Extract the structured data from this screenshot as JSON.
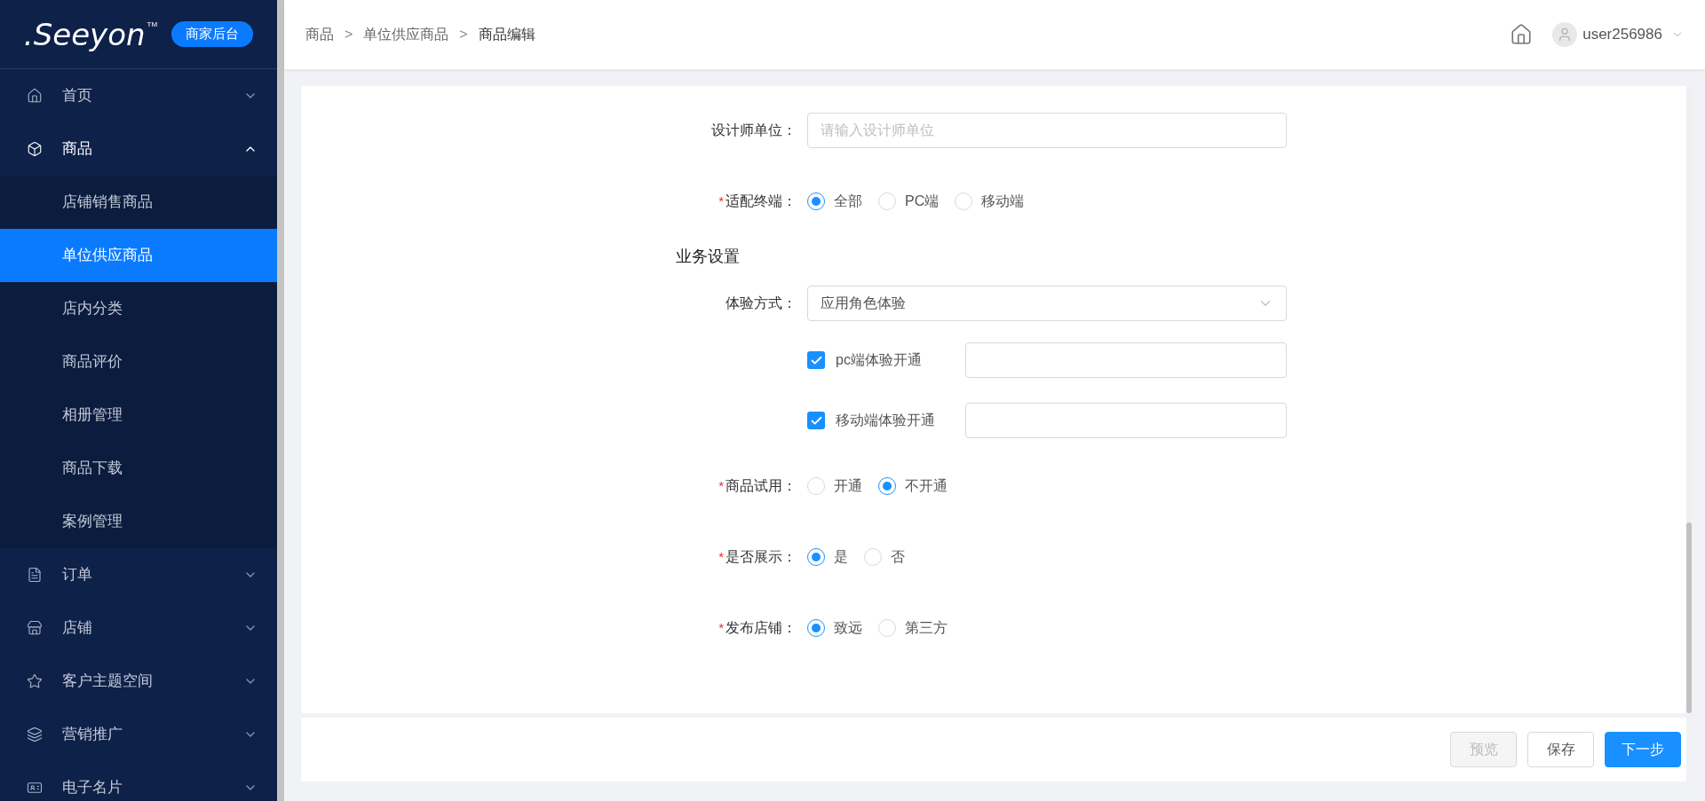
{
  "logo": {
    "text": ".Seeyon",
    "tm": "TM",
    "badge": "商家后台"
  },
  "sidebar": {
    "items": [
      {
        "label": "首页",
        "expanded": false
      },
      {
        "label": "商品",
        "expanded": true,
        "children": [
          {
            "label": "店铺销售商品",
            "selected": false
          },
          {
            "label": "单位供应商品",
            "selected": true
          },
          {
            "label": "店内分类",
            "selected": false
          },
          {
            "label": "商品评价",
            "selected": false
          },
          {
            "label": "相册管理",
            "selected": false
          },
          {
            "label": "商品下载",
            "selected": false
          },
          {
            "label": "案例管理",
            "selected": false
          }
        ]
      },
      {
        "label": "订单",
        "expanded": false
      },
      {
        "label": "店铺",
        "expanded": false
      },
      {
        "label": "客户主题空间",
        "expanded": false
      },
      {
        "label": "营销推广",
        "expanded": false
      },
      {
        "label": "电子名片",
        "expanded": false
      }
    ]
  },
  "breadcrumb": [
    {
      "kind": "link",
      "text": "商品"
    },
    {
      "kind": "sep",
      "text": ">"
    },
    {
      "kind": "link",
      "text": "单位供应商品"
    },
    {
      "kind": "sep",
      "text": ">"
    },
    {
      "kind": "current",
      "text": "商品编辑"
    }
  ],
  "user": {
    "name": "user256986"
  },
  "form": [
    {
      "kind": "input",
      "label": "设计师单位：",
      "required": false,
      "placeholder": "请输入设计师单位"
    },
    {
      "kind": "radio",
      "label": "适配终端：",
      "required": true,
      "options": [
        {
          "label": "全部",
          "selected": true
        },
        {
          "label": "PC端",
          "selected": false
        },
        {
          "label": "移动端",
          "selected": false
        }
      ]
    },
    {
      "kind": "section",
      "label": "业务设置"
    },
    {
      "kind": "select",
      "label": "体验方式：",
      "required": false,
      "value": "应用角色体验"
    },
    {
      "kind": "check",
      "label": "pc端体验开通",
      "checked": true
    },
    {
      "kind": "check",
      "label": "移动端体验开通",
      "checked": true
    },
    {
      "kind": "radio",
      "label": "商品试用：",
      "required": true,
      "options": [
        {
          "label": "开通",
          "selected": false
        },
        {
          "label": "不开通",
          "selected": true
        }
      ]
    },
    {
      "kind": "radio",
      "label": "是否展示：",
      "required": true,
      "options": [
        {
          "label": "是",
          "selected": true
        },
        {
          "label": "否",
          "selected": false
        }
      ]
    },
    {
      "kind": "radio",
      "label": "发布店铺：",
      "required": true,
      "options": [
        {
          "label": "致远",
          "selected": true
        },
        {
          "label": "第三方",
          "selected": false
        }
      ]
    }
  ],
  "required_mark": "*",
  "buttons": [
    {
      "label": "预览",
      "kind": "default",
      "disabled": true
    },
    {
      "label": "保存",
      "kind": "default",
      "disabled": false
    },
    {
      "label": "下一步",
      "kind": "primary",
      "disabled": false
    }
  ]
}
